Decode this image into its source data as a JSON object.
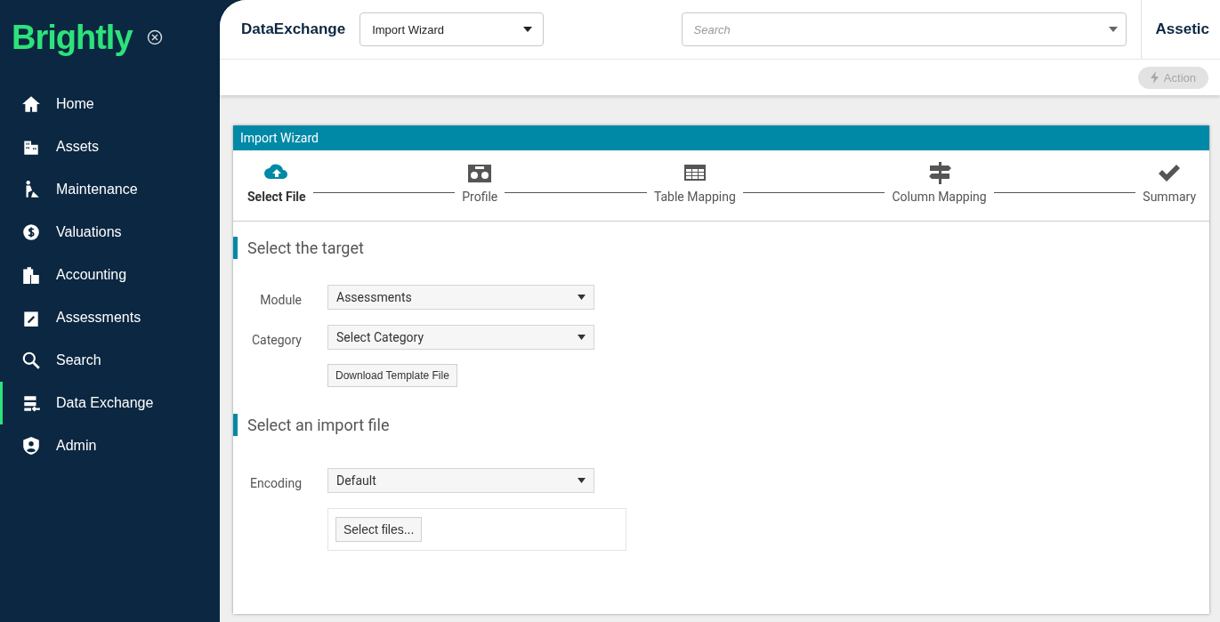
{
  "logo": "Brightly",
  "sidebar": {
    "items": [
      {
        "label": "Home",
        "selected": false
      },
      {
        "label": "Assets",
        "selected": false
      },
      {
        "label": "Maintenance",
        "selected": false
      },
      {
        "label": "Valuations",
        "selected": false
      },
      {
        "label": "Accounting",
        "selected": false
      },
      {
        "label": "Assessments",
        "selected": false
      },
      {
        "label": "Search",
        "selected": false
      },
      {
        "label": "Data Exchange",
        "selected": true
      },
      {
        "label": "Admin",
        "selected": false
      }
    ]
  },
  "header": {
    "title": "DataExchange",
    "page_select": "Import Wizard",
    "search": {
      "placeholder": "Search"
    },
    "tenant": "Assetic",
    "action": {
      "label": "Action",
      "disabled": true
    }
  },
  "wizard": {
    "title": "Import Wizard",
    "steps": [
      {
        "label": "Select File",
        "selected": true
      },
      {
        "label": "Profile",
        "selected": false
      },
      {
        "label": "Table Mapping",
        "selected": false
      },
      {
        "label": "Column Mapping",
        "selected": false
      },
      {
        "label": "Summary",
        "selected": false
      }
    ],
    "sections": [
      {
        "heading": "Select the target",
        "fields": [
          {
            "label": "Module",
            "value": "Assessments"
          },
          {
            "label": "Category",
            "value": "Select Category"
          }
        ],
        "button": "Download Template File"
      },
      {
        "heading": "Select an import file",
        "fields": [
          {
            "label": "Encoding",
            "value": "Default"
          }
        ],
        "upload": "Select files..."
      }
    ]
  }
}
